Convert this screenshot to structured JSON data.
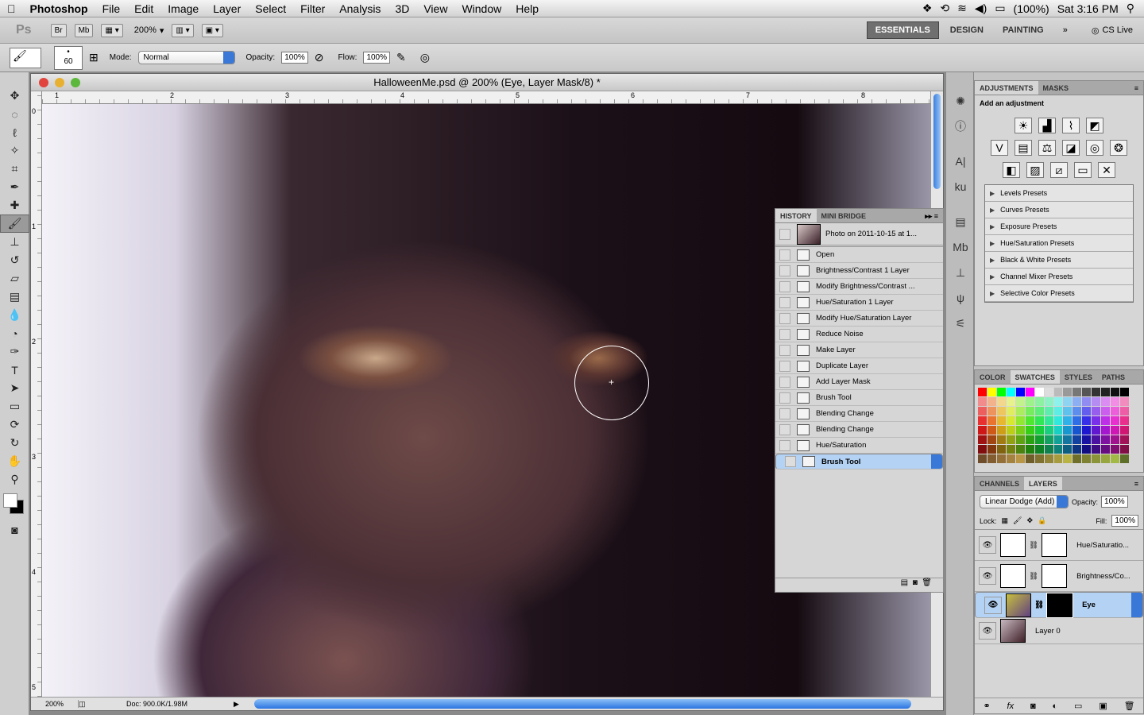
{
  "menubar": {
    "app": "Photoshop",
    "items": [
      "File",
      "Edit",
      "Image",
      "Layer",
      "Select",
      "Filter",
      "Analysis",
      "3D",
      "View",
      "Window",
      "Help"
    ],
    "battery": "(100%)",
    "clock": "Sat 3:16 PM"
  },
  "appbar": {
    "logo": "Ps",
    "br": "Br",
    "mb": "Mb",
    "zoom": "200%",
    "workspaces": [
      "ESSENTIALS",
      "DESIGN",
      "PAINTING"
    ],
    "more": "»",
    "cslive": "CS Live"
  },
  "options": {
    "brush_size": "60",
    "mode_label": "Mode:",
    "mode": "Normal",
    "opacity_label": "Opacity:",
    "opacity": "100%",
    "flow_label": "Flow:",
    "flow": "100%"
  },
  "document": {
    "title": "HalloweenMe.psd @ 200% (Eye, Layer Mask/8) *",
    "ruler_h": [
      "1",
      "2",
      "3",
      "4",
      "5",
      "6",
      "7",
      "8"
    ],
    "ruler_v": [
      "0",
      "1",
      "2",
      "3",
      "4",
      "5"
    ],
    "zoom": "200%",
    "doc_info": "Doc: 900.0K/1.98M"
  },
  "history": {
    "tabs": [
      "HISTORY",
      "MINI BRIDGE"
    ],
    "snapshot": "Photo on 2011-10-15 at 1...",
    "items": [
      "Open",
      "Brightness/Contrast 1 Layer",
      "Modify Brightness/Contrast ...",
      "Hue/Saturation 1 Layer",
      "Modify Hue/Saturation Layer",
      "Reduce Noise",
      "Make Layer",
      "Duplicate Layer",
      "Add Layer Mask",
      "Brush Tool",
      "Blending Change",
      "Blending Change",
      "Hue/Saturation",
      "Brush Tool"
    ],
    "selected_index": 13
  },
  "adjustments": {
    "tabs": [
      "ADJUSTMENTS",
      "MASKS"
    ],
    "heading": "Add an adjustment",
    "presets": [
      "Levels Presets",
      "Curves Presets",
      "Exposure Presets",
      "Hue/Saturation Presets",
      "Black & White Presets",
      "Channel Mixer Presets",
      "Selective Color Presets"
    ]
  },
  "swatches": {
    "tabs": [
      "COLOR",
      "SWATCHES",
      "STYLES",
      "PATHS"
    ]
  },
  "layers": {
    "tabs": [
      "CHANNELS",
      "LAYERS"
    ],
    "blend": "Linear Dodge (Add)",
    "opacity_label": "Opacity:",
    "opacity": "100%",
    "lock_label": "Lock:",
    "fill_label": "Fill:",
    "fill": "100%",
    "items": [
      {
        "name": "Hue/Saturatio...",
        "kind": "adjustment"
      },
      {
        "name": "Brightness/Co...",
        "kind": "adjustment"
      },
      {
        "name": "Eye",
        "kind": "masked",
        "selected": true
      },
      {
        "name": "Layer 0",
        "kind": "pixel"
      }
    ]
  }
}
